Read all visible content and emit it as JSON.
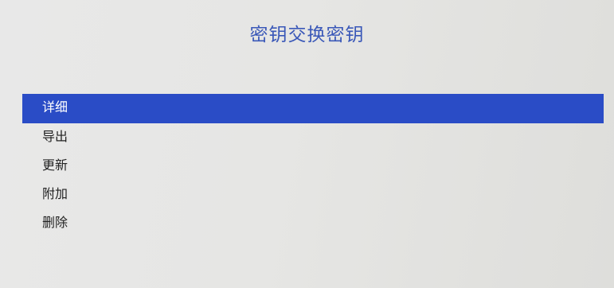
{
  "screen": {
    "title": "密钥交换密钥"
  },
  "menu": {
    "selected_index": 0,
    "items": [
      {
        "label": "详细"
      },
      {
        "label": "导出"
      },
      {
        "label": "更新"
      },
      {
        "label": "附加"
      },
      {
        "label": "删除"
      }
    ]
  },
  "colors": {
    "title": "#3a58b8",
    "selection_bar": "#2a4cc6",
    "selected_text": "#ffffff",
    "item_text": "#222222",
    "background": "#e6e6e4"
  }
}
